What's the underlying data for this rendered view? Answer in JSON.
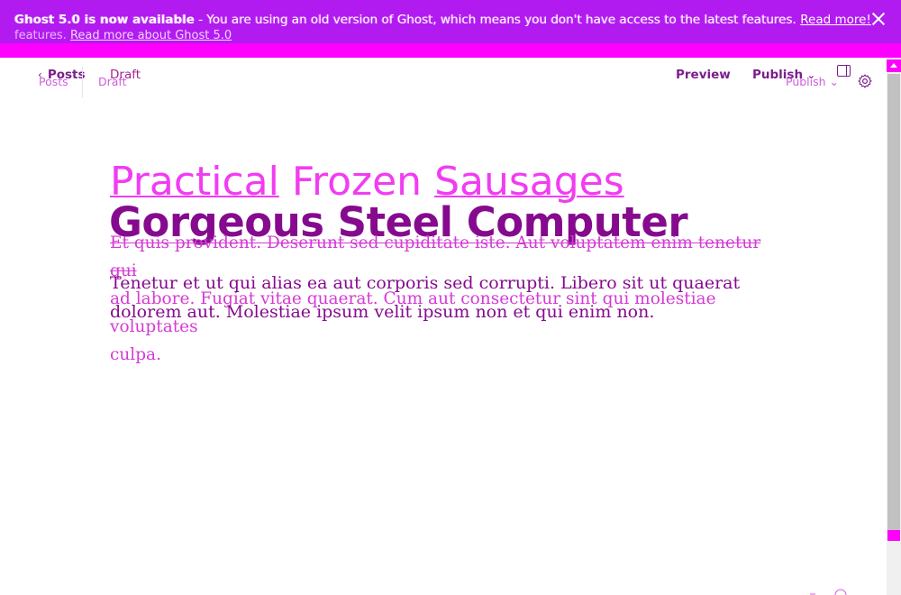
{
  "banner": {
    "strong": "Ghost 5.0 is now available",
    "message": " - You are using an old version of Ghost, which means you don't have access to the latest features.",
    "link": "Read more!",
    "ghost_prefix": "features.",
    "ghost_link": "Read more about Ghost 5.0"
  },
  "header": {
    "back_label": "Posts",
    "back_ghost": "Posts",
    "status": "Draft",
    "status_ghost": "Draft",
    "preview_label": "Preview",
    "publish_label": "Publish",
    "publish_ghost": "Publish"
  },
  "editor": {
    "title_ghost_parts": [
      "Practical",
      "Frozen",
      "Sausages"
    ],
    "title": "Gorgeous Steel Computer",
    "excerpt_ghost_line1": "Et quis provident. Deserunt sed cupiditate iste. Aut voluptatem enim tenetur qui",
    "excerpt_ghost_line2": "ad labore. Fugiat vitae quaerat. Cum aut consectetur sint qui molestiae voluptates",
    "excerpt_ghost_line3": "culpa.",
    "body": "Tenetur et ut qui alias ea aut corporis sed corrupti. Libero sit ut quaerat dolorem aut. Molestiae ipsum velit ipsum non et qui enim non."
  },
  "icons": {
    "back": "chevron-left-icon",
    "publish_dropdown": "chevron-down-icon",
    "sidebar": "sidebar-toggle-icon",
    "settings": "gear-icon",
    "close": "close-icon"
  },
  "colors": {
    "banner": "#b21bf0",
    "accent": "#ff00ff",
    "primary_text": "#850a8e",
    "ghost_text": "#f23cf2"
  }
}
